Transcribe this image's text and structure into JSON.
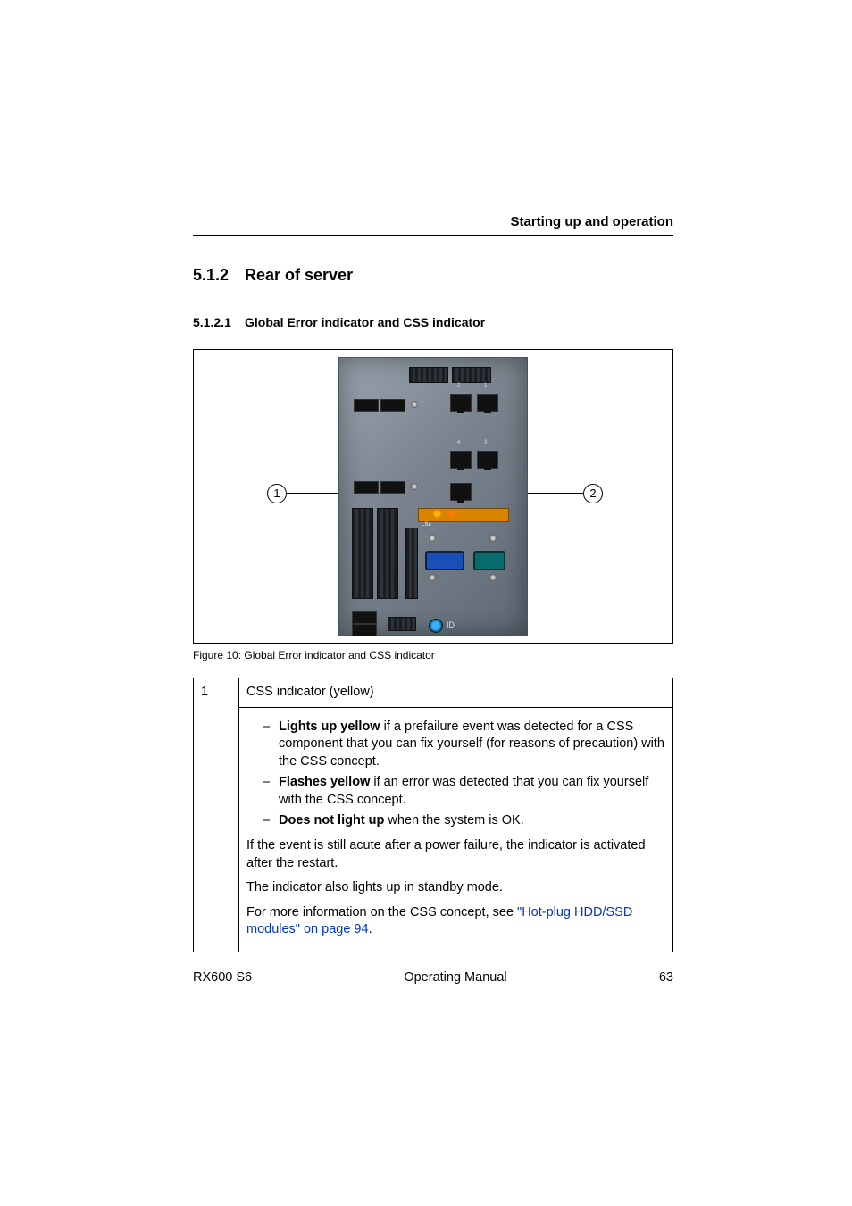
{
  "header": {
    "running_title": "Starting up and operation"
  },
  "section": {
    "number": "5.1.2",
    "title": "Rear of server"
  },
  "subsection": {
    "number": "5.1.2.1",
    "title": "Global Error indicator and CSS indicator"
  },
  "figure": {
    "callout1": "1",
    "callout2": "2",
    "caption": "Figure 10: Global Error indicator and CSS indicator",
    "panel_labels": {
      "top_right": "1",
      "top_left": "2",
      "mid_left": "4",
      "mid_right": "3",
      "lsa": "LSa",
      "id": "ID"
    }
  },
  "table": {
    "row1": {
      "index": "1",
      "title": "CSS indicator (yellow)",
      "bullets": [
        {
          "bold": "Lights up yellow",
          "rest": " if a prefailure event was detected for a CSS component that you can fix yourself (for reasons of precaution) with the CSS concept."
        },
        {
          "bold": "Flashes yellow",
          "rest": " if an error was detected that you can fix yourself with the CSS concept."
        },
        {
          "bold": "Does not light up",
          "rest": " when the system is OK."
        }
      ],
      "p1": "If the event is still acute after a power failure, the indicator is activated after the restart.",
      "p2": "The indicator also lights up in standby mode.",
      "p3_prefix": "For more information on the CSS concept, see ",
      "p3_link": "\"Hot-plug HDD/SSD modules\" on page 94",
      "p3_suffix": "."
    }
  },
  "footer": {
    "left": "RX600 S6",
    "center": "Operating Manual",
    "right": "63"
  }
}
